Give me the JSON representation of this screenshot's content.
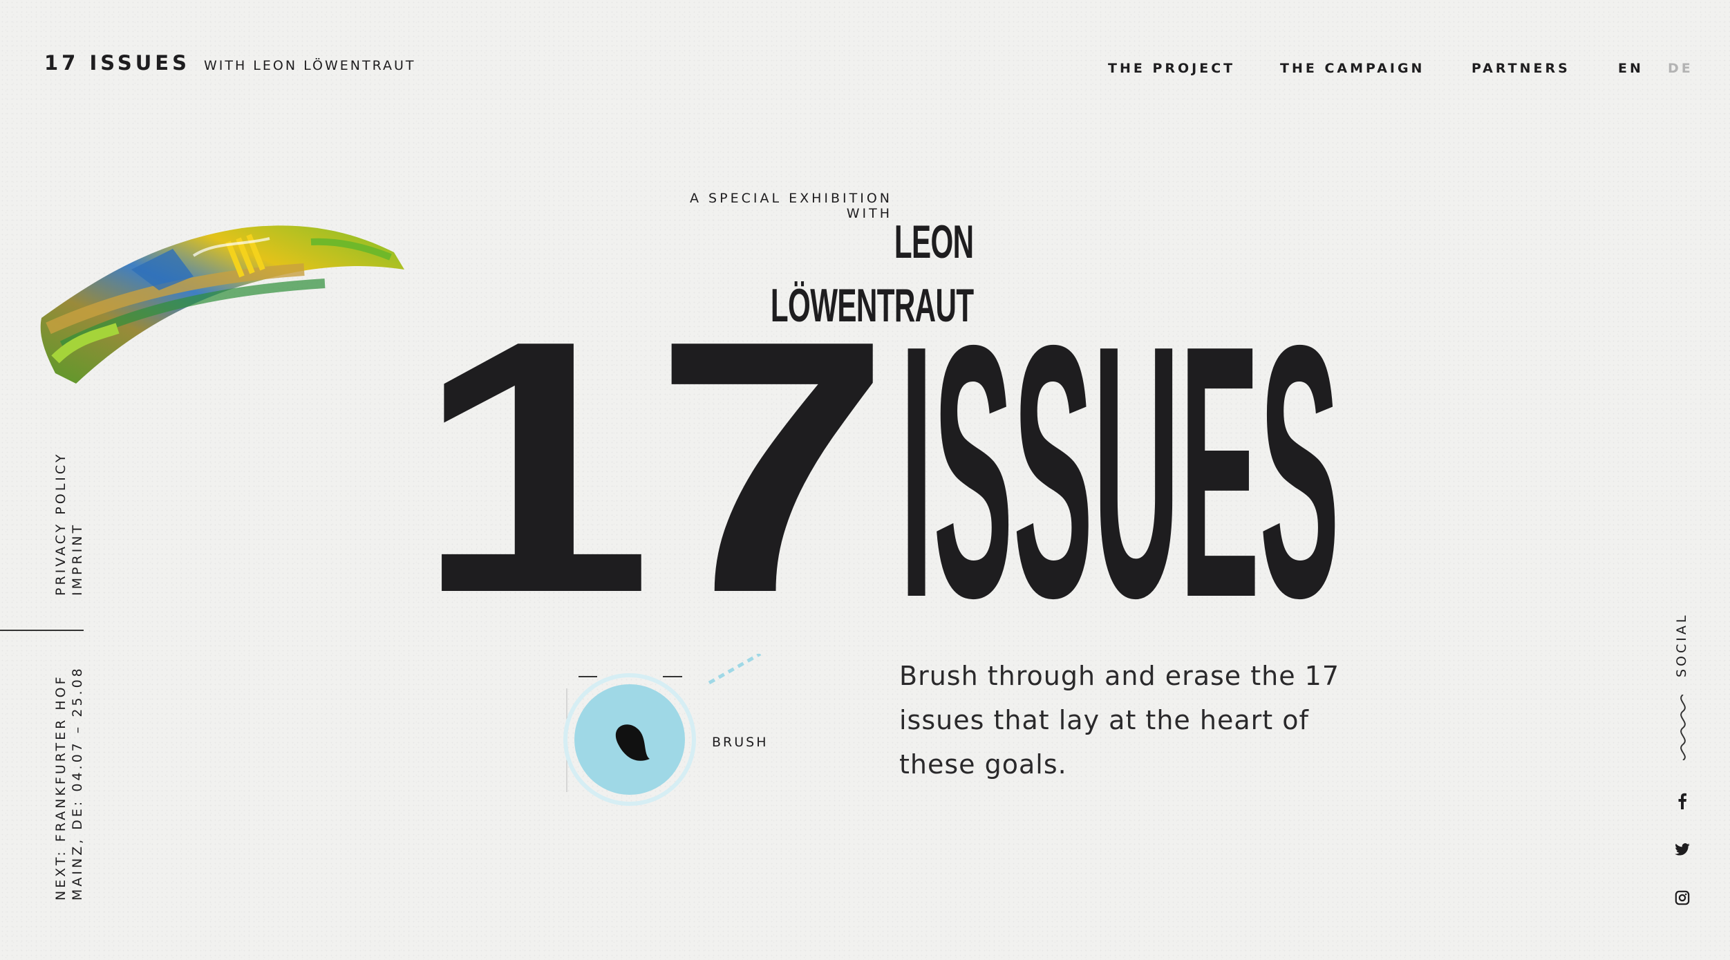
{
  "header": {
    "logo_main": "17 ISSUES",
    "logo_sub": "WITH LEON LÖWENTRAUT",
    "nav": [
      {
        "label": "THE PROJECT"
      },
      {
        "label": "THE CAMPAIGN"
      },
      {
        "label": "PARTNERS"
      }
    ],
    "lang_en": "EN",
    "lang_de": "DE"
  },
  "sidebar_left": {
    "privacy": "PRIVACY POLICY",
    "imprint": "IMPRINT",
    "next_line1": "NEXT: FRANKFURTER HOF",
    "next_line2": "MAINZ, DE: 04.07 – 25.08"
  },
  "hero": {
    "kicker": "A SPECIAL EXHIBITION WITH",
    "artist": "LEON LÖWENTRAUT",
    "title_number": "17",
    "title_word": "ISSUES",
    "brush_label": "BRUSH",
    "description": "Brush through and erase the 17 issues that lay at the heart of these goals."
  },
  "social": {
    "label": "SOCIAL",
    "icons": [
      "facebook-icon",
      "twitter-icon",
      "instagram-icon"
    ]
  },
  "colors": {
    "ink": "#1e1d1f",
    "background": "#f1f1ef",
    "accent_blue": "#9fd8e6",
    "inactive": "#b3b3b3"
  }
}
